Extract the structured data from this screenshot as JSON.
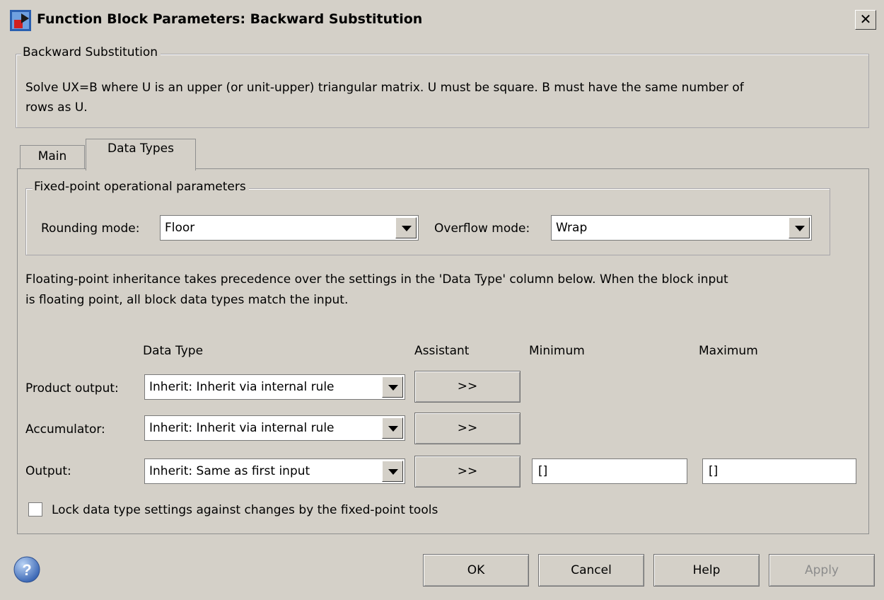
{
  "window": {
    "title": "Function Block Parameters: Backward Substitution",
    "close_glyph": "✕"
  },
  "description": {
    "group_title": "Backward Substitution",
    "text_line1": "Solve UX=B where U is an upper (or unit-upper) triangular matrix.  U must be square.  B must have the same number of",
    "text_line2": "rows as U."
  },
  "tabs": [
    {
      "label": "Main",
      "active": false
    },
    {
      "label": "Data Types",
      "active": true
    }
  ],
  "fixed_point": {
    "group_title": "Fixed-point operational parameters",
    "rounding_label": "Rounding mode:",
    "rounding_value": "Floor",
    "overflow_label": "Overflow mode:",
    "overflow_value": "Wrap"
  },
  "note": {
    "line1": "Floating-point inheritance takes precedence over the settings in the 'Data Type' column below. When the block input",
    "line2": "is floating point, all block data types match the input."
  },
  "table": {
    "headers": {
      "data_type": "Data Type",
      "assistant": "Assistant",
      "minimum": "Minimum",
      "maximum": "Maximum"
    },
    "rows": [
      {
        "label": "Product output:",
        "data_type": "Inherit: Inherit via internal rule",
        "assistant": ">>"
      },
      {
        "label": "Accumulator:",
        "data_type": "Inherit: Inherit via internal rule",
        "assistant": ">>"
      },
      {
        "label": "Output:",
        "data_type": "Inherit: Same as first input",
        "assistant": ">>",
        "minimum": "[]",
        "maximum": "[]"
      }
    ]
  },
  "lock": {
    "label": "Lock data type settings against changes by the fixed-point tools",
    "checked": false
  },
  "footer": {
    "ok": "OK",
    "cancel": "Cancel",
    "help": "Help",
    "apply": "Apply",
    "help_icon_glyph": "?"
  },
  "colors": {
    "dialog_bg": "#d4d0c8",
    "help_icon": "#4a78c0"
  }
}
